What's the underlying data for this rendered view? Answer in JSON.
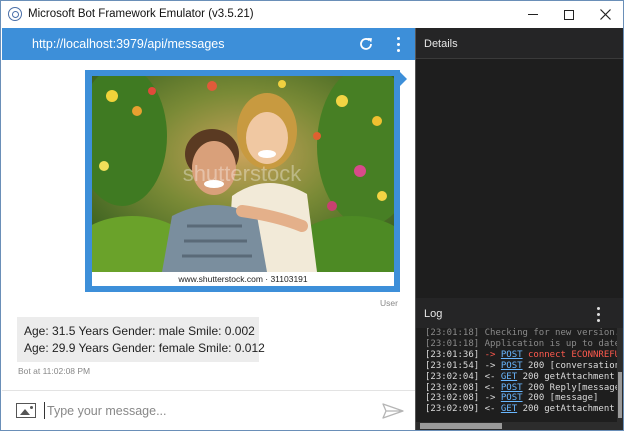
{
  "window": {
    "title": "Microsoft Bot Framework Emulator (v3.5.21)",
    "controls": {
      "minimize": "minimize-icon",
      "maximize": "maximize-icon",
      "close": "close-icon"
    }
  },
  "chat": {
    "url": "http://localhost:3979/api/messages",
    "photo_caption": "www.shutterstock.com · 31103191",
    "user_label": "User",
    "bot_lines": [
      "Age: 31.5 Years Gender: male Smile: 0.002",
      "Age: 29.9 Years Gender: female Smile: 0.012"
    ],
    "bot_timestamp": "Bot at 11:02:08 PM",
    "input_placeholder": "Type your message...",
    "header_color": "#3d8fd9"
  },
  "details": {
    "title": "Details"
  },
  "log": {
    "title": "Log",
    "entries": [
      {
        "time": "[23:01:18]",
        "text": "Checking for new version...",
        "faded": true
      },
      {
        "time": "[23:01:18]",
        "text": "Application is up to date.",
        "faded": true
      },
      {
        "time": "[23:01:36]",
        "arrow": "->",
        "verb": "POST",
        "status": "connect ECONNREFUSED",
        "error": true
      },
      {
        "time": "[23:01:54]",
        "arrow": "->",
        "verb": "POST",
        "status": "200",
        "detail": "[conversationUpdate]"
      },
      {
        "time": "[23:02:04]",
        "arrow": "<-",
        "verb": "GET",
        "status": "200",
        "detail": "getAttachment"
      },
      {
        "time": "[23:02:08]",
        "arrow": "<-",
        "verb": "POST",
        "status": "200",
        "detail": "Reply[message]"
      },
      {
        "time": "[23:02:08]",
        "arrow": "->",
        "verb": "POST",
        "status": "200",
        "detail": "[message]"
      },
      {
        "time": "[23:02:09]",
        "arrow": "<-",
        "verb": "GET",
        "status": "200",
        "detail": "getAttachment"
      }
    ]
  }
}
